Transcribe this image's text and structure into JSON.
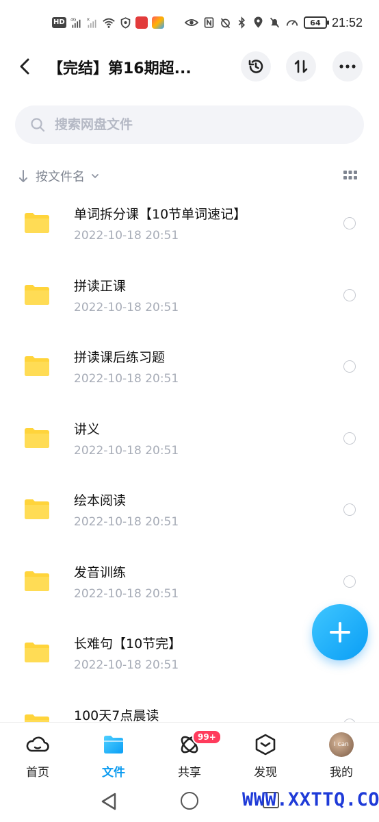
{
  "status_bar": {
    "time": "21:52",
    "battery": "64",
    "hd_label": "HD",
    "network": "4G"
  },
  "header": {
    "title": "【完结】第16期超...",
    "back_icon": "chevron-left-icon",
    "history_icon": "history-clock-icon",
    "sort_icon": "sort-arrows-icon",
    "more_icon": "more-dots-icon"
  },
  "search": {
    "placeholder": "搜索网盘文件"
  },
  "sort": {
    "label": "按文件名"
  },
  "files": [
    {
      "name": "单词拆分课【10节单词速记】",
      "date": "2022-10-18  20:51"
    },
    {
      "name": "拼读正课",
      "date": "2022-10-18  20:51"
    },
    {
      "name": "拼读课后练习题",
      "date": "2022-10-18  20:51"
    },
    {
      "name": "讲义",
      "date": "2022-10-18  20:51"
    },
    {
      "name": "绘本阅读",
      "date": "2022-10-18  20:51"
    },
    {
      "name": "发音训练",
      "date": "2022-10-18  20:51"
    },
    {
      "name": "长难句【10节完】",
      "date": "2022-10-18  20:51"
    },
    {
      "name": "100天7点晨读",
      "date": ""
    }
  ],
  "bottom_nav": {
    "tabs": [
      {
        "label": "首页",
        "icon": "cloud-icon"
      },
      {
        "label": "文件",
        "icon": "folder-icon"
      },
      {
        "label": "共享",
        "icon": "share-orbit-icon",
        "badge": "99+"
      },
      {
        "label": "发现",
        "icon": "discover-box-icon"
      },
      {
        "label": "我的",
        "icon": "avatar"
      }
    ],
    "active_index": 1
  },
  "avatar_text": "I can",
  "watermark": "WWW.XXTTQ.COM",
  "colors": {
    "accent": "#0b9bf0",
    "folder": "#ffd43b",
    "badge": "#ff3b5c"
  }
}
